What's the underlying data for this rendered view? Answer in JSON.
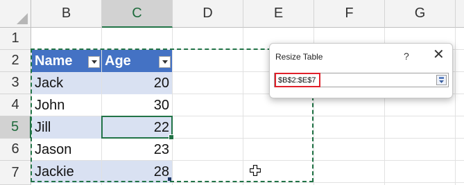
{
  "sheet": {
    "columns": [
      "B",
      "C",
      "D",
      "E",
      "F",
      "G"
    ],
    "rows": [
      "1",
      "2",
      "3",
      "4",
      "5",
      "6",
      "7"
    ],
    "selected_column": "C",
    "selected_row": "5"
  },
  "table": {
    "headers": [
      "Name",
      "Age"
    ],
    "rows": [
      {
        "name": "Jack",
        "age": "20"
      },
      {
        "name": "John",
        "age": "30"
      },
      {
        "name": "Jill",
        "age": "22"
      },
      {
        "name": "Jason",
        "age": "23"
      },
      {
        "name": "Jackie",
        "age": "28"
      }
    ],
    "header_color": "#4472c4",
    "band_color": "#d9e1f2"
  },
  "dialog": {
    "title": "Resize Table",
    "help_label": "?",
    "close_label": "✕",
    "range_value": "$B$2:$E$7"
  },
  "colors": {
    "accent": "#217346",
    "highlight": "#e0202a"
  },
  "icons": {
    "cursor": "plus-cross-cursor",
    "collapse": "collapse-dialog-icon"
  }
}
